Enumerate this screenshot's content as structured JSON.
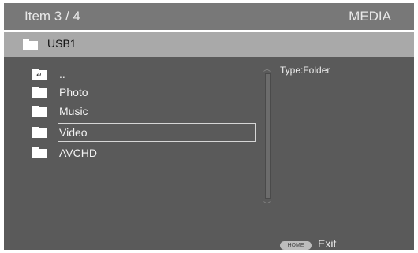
{
  "header": {
    "item_counter": "Item 3 / 4",
    "section": "MEDIA"
  },
  "path": {
    "label": "USB1",
    "icon": "folder-icon"
  },
  "list": {
    "items": [
      {
        "label": "..",
        "icon": "folder-up-icon"
      },
      {
        "label": "Photo",
        "icon": "folder-icon"
      },
      {
        "label": "Music",
        "icon": "folder-icon"
      },
      {
        "label": "Video",
        "icon": "folder-icon",
        "selected": true
      },
      {
        "label": "AVCHD",
        "icon": "folder-icon"
      }
    ]
  },
  "info": {
    "type": "Type:Folder"
  },
  "footer": {
    "home_label": "HOME",
    "exit_label": "Exit"
  },
  "colors": {
    "header_bg": "#787878",
    "path_bg": "#a9a9a9",
    "content_bg": "#5a5a5a"
  }
}
